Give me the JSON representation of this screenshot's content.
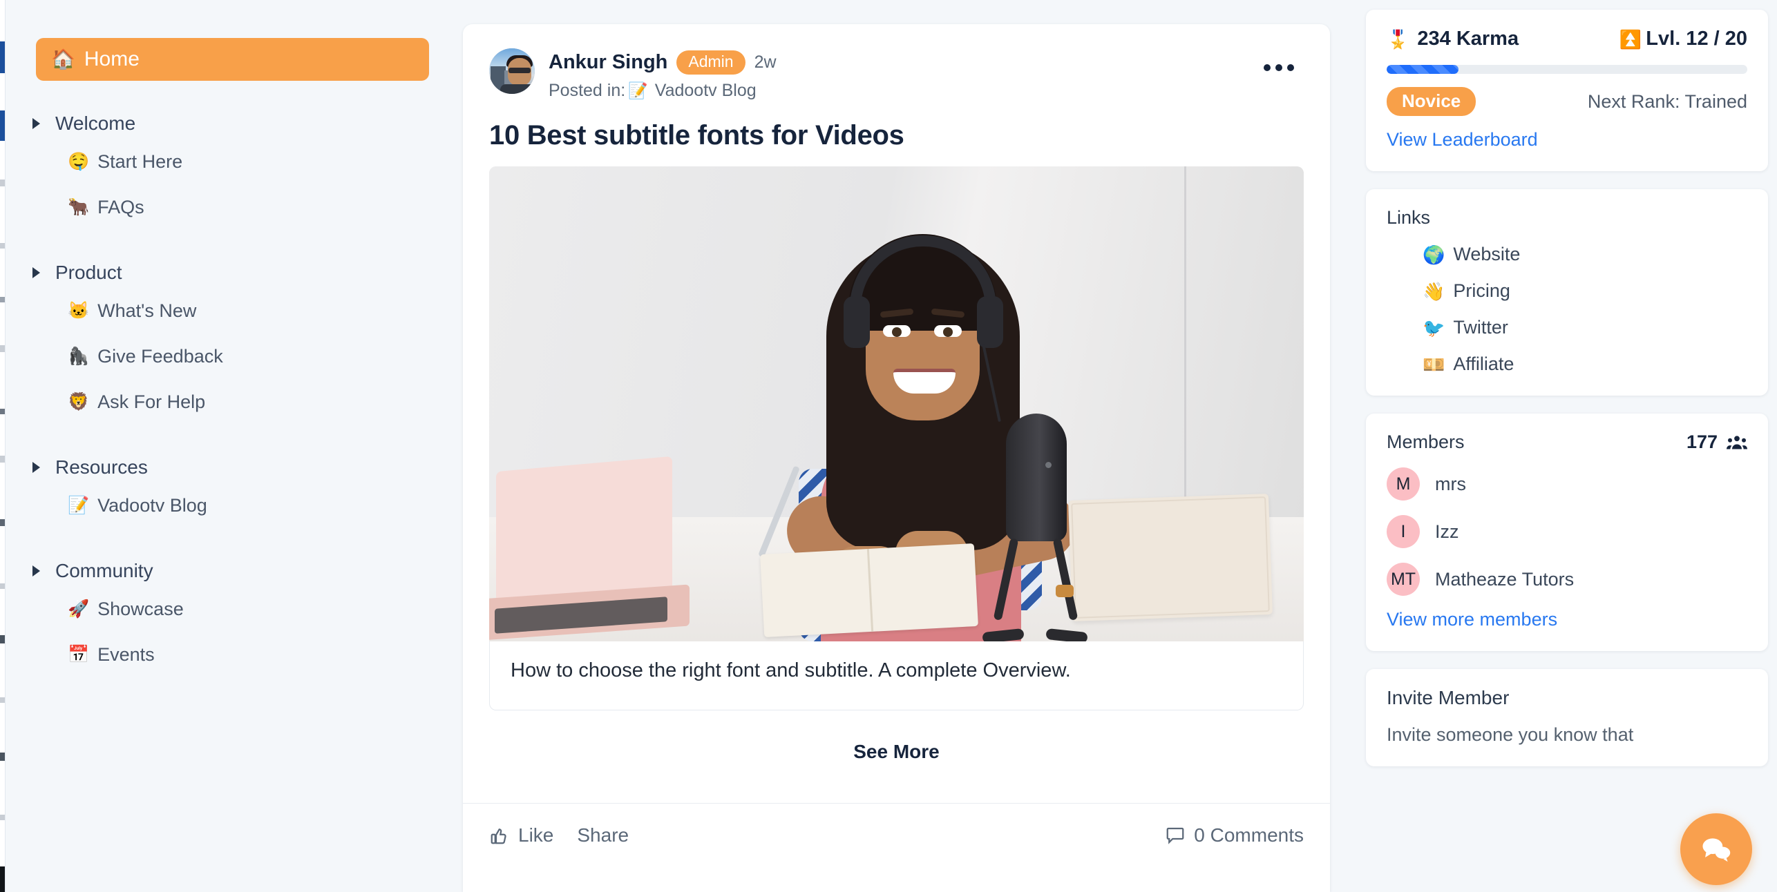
{
  "sidebar": {
    "home": {
      "label": "Home",
      "icon": "home-icon"
    },
    "groups": [
      {
        "label": "Welcome",
        "items": [
          {
            "emoji": "🤤",
            "label": "Start Here"
          },
          {
            "emoji": "🐂",
            "label": "FAQs"
          }
        ]
      },
      {
        "label": "Product",
        "items": [
          {
            "emoji": "🐱",
            "label": "What's New"
          },
          {
            "emoji": "🦍",
            "label": "Give Feedback"
          },
          {
            "emoji": "🦁",
            "label": "Ask For Help"
          }
        ]
      },
      {
        "label": "Resources",
        "items": [
          {
            "emoji": "📝",
            "label": "Vadootv Blog"
          }
        ]
      },
      {
        "label": "Community",
        "items": [
          {
            "emoji": "🚀",
            "label": "Showcase"
          },
          {
            "emoji": "📅",
            "label": "Events"
          }
        ]
      }
    ]
  },
  "post": {
    "author": "Ankur Singh",
    "author_badge": "Admin",
    "time": "2w",
    "posted_in_prefix": "Posted in:",
    "posted_in_emoji": "📝",
    "posted_in": "Vadootv Blog",
    "title": "10 Best subtitle fonts for Videos",
    "excerpt": "How to choose the right font and subtitle. A complete Overview.",
    "see_more": "See More",
    "like_label": "Like",
    "share_label": "Share",
    "comments_label": "0 Comments"
  },
  "karma": {
    "medal_emoji": "🎖️",
    "karma_text": "234 Karma",
    "level_emoji": "⏫",
    "level_text": "Lvl. 12 / 20",
    "progress_percent": 20,
    "rank": "Novice",
    "next_rank": "Next Rank: Trained",
    "leaderboard_link": "View Leaderboard",
    "accent": "#f8a049",
    "progress_color": "#1f6dfb"
  },
  "links": {
    "title": "Links",
    "items": [
      {
        "emoji": "🌍",
        "label": "Website"
      },
      {
        "emoji": "👋",
        "label": "Pricing"
      },
      {
        "emoji": "🐦",
        "label": "Twitter"
      },
      {
        "emoji": "💴",
        "label": "Affiliate"
      }
    ]
  },
  "members": {
    "title": "Members",
    "count": "177",
    "list": [
      {
        "initials": "M",
        "name": "mrs"
      },
      {
        "initials": "I",
        "name": "Izz"
      },
      {
        "initials": "MT",
        "name": "Matheaze Tutors"
      }
    ],
    "view_more": "View more members",
    "avatar_color": "#fbbec4"
  },
  "invite": {
    "title": "Invite Member",
    "subtitle": "Invite someone you know that"
  },
  "fab": {
    "icon": "chat-bubbles-icon",
    "color": "#f9a04e"
  }
}
